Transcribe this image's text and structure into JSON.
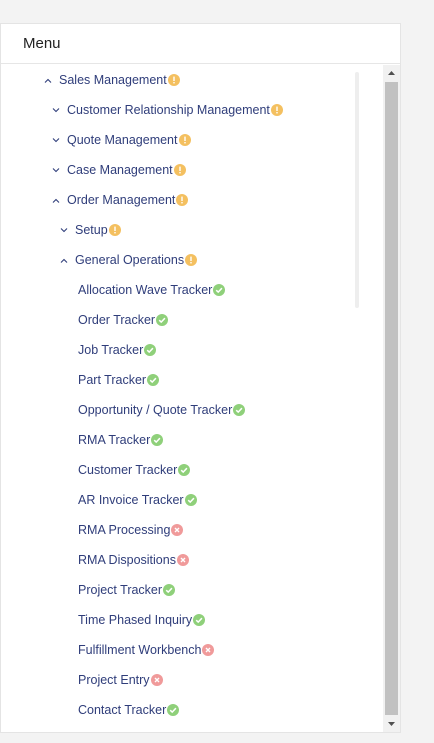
{
  "menu": {
    "title": "Menu"
  },
  "colors": {
    "warning": "#f4c060",
    "success": "#8fd07a",
    "error": "#f09a9a",
    "text": "#2f3d7a"
  },
  "tree": [
    {
      "label": "Sales Management",
      "level": 0,
      "state": "expanded",
      "status": "warning"
    },
    {
      "label": "Customer Relationship Management",
      "level": 1,
      "state": "collapsed",
      "status": "warning"
    },
    {
      "label": "Quote Management",
      "level": 1,
      "state": "collapsed",
      "status": "warning"
    },
    {
      "label": "Case Management",
      "level": 1,
      "state": "collapsed",
      "status": "warning"
    },
    {
      "label": "Order Management",
      "level": 1,
      "state": "expanded",
      "status": "warning"
    },
    {
      "label": "Setup",
      "level": 2,
      "state": "collapsed",
      "status": "warning"
    },
    {
      "label": "General Operations",
      "level": 2,
      "state": "expanded",
      "status": "warning"
    },
    {
      "label": "Allocation Wave Tracker",
      "level": 3,
      "state": "leaf",
      "status": "success"
    },
    {
      "label": "Order Tracker",
      "level": 3,
      "state": "leaf",
      "status": "success"
    },
    {
      "label": "Job Tracker",
      "level": 3,
      "state": "leaf",
      "status": "success"
    },
    {
      "label": "Part Tracker",
      "level": 3,
      "state": "leaf",
      "status": "success"
    },
    {
      "label": "Opportunity / Quote Tracker",
      "level": 3,
      "state": "leaf",
      "status": "success"
    },
    {
      "label": "RMA Tracker",
      "level": 3,
      "state": "leaf",
      "status": "success"
    },
    {
      "label": "Customer Tracker",
      "level": 3,
      "state": "leaf",
      "status": "success"
    },
    {
      "label": "AR Invoice Tracker",
      "level": 3,
      "state": "leaf",
      "status": "success"
    },
    {
      "label": "RMA Processing",
      "level": 3,
      "state": "leaf",
      "status": "error"
    },
    {
      "label": "RMA Dispositions",
      "level": 3,
      "state": "leaf",
      "status": "error"
    },
    {
      "label": "Project Tracker",
      "level": 3,
      "state": "leaf",
      "status": "success"
    },
    {
      "label": "Time Phased Inquiry",
      "level": 3,
      "state": "leaf",
      "status": "success"
    },
    {
      "label": "Fulfillment Workbench",
      "level": 3,
      "state": "leaf",
      "status": "error"
    },
    {
      "label": "Project Entry",
      "level": 3,
      "state": "leaf",
      "status": "error"
    },
    {
      "label": "Contact Tracker",
      "level": 3,
      "state": "leaf",
      "status": "success"
    }
  ]
}
